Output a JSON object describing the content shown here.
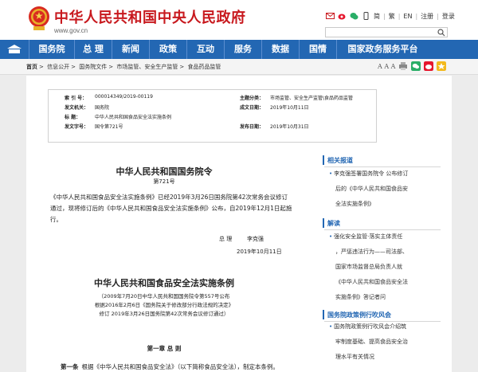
{
  "header": {
    "site_title": "中华人民共和国中央人民政府",
    "site_url": "www.gov.cn",
    "top_links": [
      "简",
      "繁",
      "EN",
      "注册",
      "登录"
    ],
    "search_placeholder": ""
  },
  "nav": {
    "home_icon": "home-icon",
    "items": [
      "国务院",
      "总 理",
      "新闻",
      "政策",
      "互动",
      "服务",
      "数据",
      "国情",
      "国家政务服务平台"
    ]
  },
  "breadcrumb": [
    "首页",
    "信息公开",
    "国务院文件",
    "市场监管、安全生产监管",
    "食品药品监管"
  ],
  "share": {
    "font_size_label": "A A A"
  },
  "info": {
    "index_no_label": "索 引 号：",
    "index_no": "000014349/2019-00119",
    "topic_label": "主题分类：",
    "topic": "市场监管、安全生产监管\\食品药品监管",
    "issuer_label": "发文机关：",
    "issuer": "国务院",
    "created_label": "成文日期：",
    "created": "2019年10月11日",
    "title_label": "标    题：",
    "title": "中华人民共和国食品安全法实施条例",
    "doc_no_label": "发文字号：",
    "doc_no": "国令第721号",
    "published_label": "发布日期：",
    "published": "2019年10月31日"
  },
  "doc": {
    "title": "中华人民共和国国务院令",
    "number": "第721号",
    "para1_line1": "《中华人民共和国食品安全法实施条例》已经2019年3月26日国务院第42次常务会议修订",
    "para1_line2": "通过，现将修订后的《中华人民共和国食品安全法实施条例》公布，自2019年12月1日起施",
    "para1_line3": "行。",
    "sig_title": "总    理",
    "sig_name": "李克强",
    "sig_date": "2019年10月11日",
    "law_title": "中华人民共和国食品安全法实施条例",
    "law_note_1": "（2009年7月20日中华人民共和国国务院令第557号公布",
    "law_note_2": "根据2016年2月6日《国务院关于修改部分行政法规的决定》",
    "law_note_3": "修订    2019年3月26日国务院第42次常务会议修订通过）",
    "chapter": "第一章  总    则",
    "art_no": "第一条",
    "art_text": "根据《中华人民共和国食品安全法》（以下简称食品安全法），制定本条例。"
  },
  "sidebar": {
    "related_title": "相关报道",
    "related_items": [
      "李克强签署国务院令 公布修订",
      "后的《中华人民共和国食品安",
      "全法实施条例》"
    ],
    "interp_title": "解读",
    "interp_items": [
      "强化安全监管·落实主体责任",
      "，严惩违法行为——司法部、",
      "国家市场监督总局负责人就",
      "《中华人民共和国食品安全法",
      "实施条例》答记者问"
    ],
    "policy_title": "国务院政策例行吹风会",
    "policy_items": [
      "国务院政策例行吹风会介绍筑",
      "牢制度基础、提高食品安全治",
      "理水平有关情况"
    ]
  }
}
